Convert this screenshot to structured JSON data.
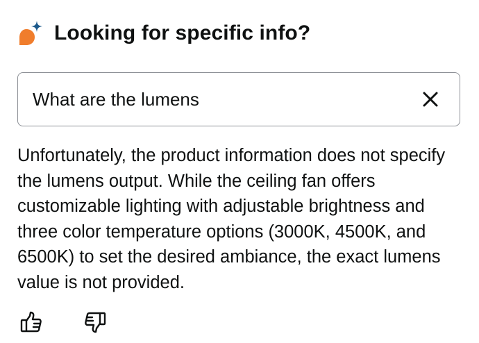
{
  "header": {
    "icon": "ai-sparkle-chat-icon",
    "title": "Looking for specific info?"
  },
  "search": {
    "value": "What are the lumens",
    "clear_icon": "close-icon"
  },
  "answer": {
    "text": "Unfortunately, the product information does not specify the lumens output. While the ceiling fan offers customizable lighting with adjustable brightness and three color temperature options (3000K, 4500K, and 6500K) to set the desired ambiance, the exact lumens value is not provided."
  },
  "feedback": {
    "up_icon": "thumbs-up-icon",
    "down_icon": "thumbs-down-icon"
  },
  "colors": {
    "accent_orange": "#f07d2c",
    "accent_blue": "#1d5a8c",
    "text": "#0f1111",
    "border": "#8d9096"
  }
}
